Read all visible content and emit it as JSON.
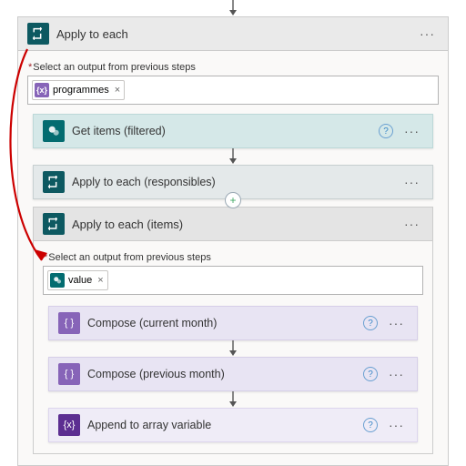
{
  "outer": {
    "title": "Apply to each",
    "selectLabel": "Select an output from previous steps",
    "token": {
      "label": "programmes",
      "chip": "{x}"
    }
  },
  "getItems": {
    "title": "Get items (filtered)"
  },
  "eachResponsibles": {
    "title": "Apply to each (responsibles)"
  },
  "eachItems": {
    "title": "Apply to each (items)",
    "selectLabel": "Select an output from previous steps",
    "token": {
      "label": "value",
      "chip": ""
    }
  },
  "composeCur": {
    "title": "Compose (current month)"
  },
  "composePrev": {
    "title": "Compose (previous month)"
  },
  "append": {
    "title": "Append to array variable"
  }
}
